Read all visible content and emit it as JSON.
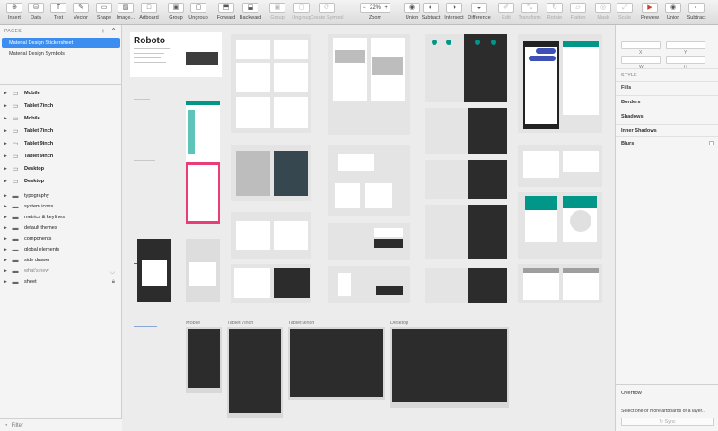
{
  "toolbar": {
    "items": [
      {
        "label": "Insert",
        "icon": "insert-icon",
        "glyph": "⊕",
        "dim": false
      },
      {
        "label": "Data",
        "icon": "data-icon",
        "glyph": "⛁",
        "dim": false
      },
      {
        "label": "Text",
        "icon": "text-icon",
        "glyph": "T",
        "dim": false
      },
      {
        "label": "Vector",
        "icon": "vector-icon",
        "glyph": "✎",
        "dim": false
      },
      {
        "label": "Shape",
        "icon": "shape-icon",
        "glyph": "▭",
        "dim": false
      },
      {
        "label": "Image...",
        "icon": "image-icon",
        "glyph": "▨",
        "dim": false
      },
      {
        "label": "Artboard",
        "icon": "artboard-icon",
        "glyph": "□",
        "dim": false
      },
      {
        "label": "Group",
        "icon": "group-icon",
        "glyph": "▣",
        "dim": false
      },
      {
        "label": "Ungroup",
        "icon": "ungroup-icon",
        "glyph": "▢",
        "dim": false
      },
      {
        "label": "Forward",
        "icon": "forward-icon",
        "glyph": "⬒",
        "dim": false
      },
      {
        "label": "Backward",
        "icon": "backward-icon",
        "glyph": "⬓",
        "dim": false
      },
      {
        "label": "Group",
        "icon": "group-selection-icon",
        "glyph": "▣",
        "dim": true
      },
      {
        "label": "Ungroup",
        "icon": "ungroup-selection-icon",
        "glyph": "▢",
        "dim": true
      },
      {
        "label": "Create Symbol",
        "icon": "create-symbol-icon",
        "glyph": "⟳",
        "dim": true
      },
      {
        "label": "Zoom",
        "icon": "zoom-icon",
        "glyph": "",
        "dim": false
      },
      {
        "label": "Union",
        "icon": "union-icon",
        "glyph": "◉",
        "dim": false
      },
      {
        "label": "Subtract",
        "icon": "subtract-icon",
        "glyph": "◐",
        "dim": false
      },
      {
        "label": "Intersect",
        "icon": "intersect-icon",
        "glyph": "◑",
        "dim": false
      },
      {
        "label": "Difference",
        "icon": "difference-icon",
        "glyph": "◒",
        "dim": false
      },
      {
        "label": "Edit",
        "icon": "edit-icon",
        "glyph": "✐",
        "dim": true
      },
      {
        "label": "Transform",
        "icon": "transform-icon",
        "glyph": "⤡",
        "dim": true
      },
      {
        "label": "Rotate",
        "icon": "rotate-icon",
        "glyph": "↻",
        "dim": true
      },
      {
        "label": "Flatten",
        "icon": "flatten-icon",
        "glyph": "▱",
        "dim": true
      },
      {
        "label": "Mask",
        "icon": "mask-icon",
        "glyph": "◎",
        "dim": true
      },
      {
        "label": "Scale",
        "icon": "scale-icon",
        "glyph": "⤢",
        "dim": true
      },
      {
        "label": "Preview",
        "icon": "preview-icon",
        "glyph": "▶",
        "dim": false
      },
      {
        "label": "Union",
        "icon": "union-right-icon",
        "glyph": "◉",
        "dim": false
      },
      {
        "label": "Subtract",
        "icon": "subtract-right-icon",
        "glyph": "◐",
        "dim": false
      }
    ],
    "zoom_value": "22%",
    "zoom_minus": "−",
    "zoom_plus": "+"
  },
  "sidebar": {
    "pages_header": "PAGES",
    "add_glyph": "+",
    "collapse_glyph": "⌃",
    "pages": [
      {
        "label": "Material Design Stickersheet",
        "active": true
      },
      {
        "label": "Material Design Symbols",
        "active": false
      }
    ],
    "layers": [
      {
        "label": "Mobile",
        "type": "artboard",
        "bold": true,
        "dim": false
      },
      {
        "label": "Tablet 7inch",
        "type": "artboard",
        "bold": true,
        "dim": false
      },
      {
        "label": "Mobile",
        "type": "artboard",
        "bold": true,
        "dim": false
      },
      {
        "label": "Tablet 7inch",
        "type": "artboard",
        "bold": true,
        "dim": false
      },
      {
        "label": "Tablet 9inch",
        "type": "artboard",
        "bold": true,
        "dim": false
      },
      {
        "label": "Tablet 9inch",
        "type": "artboard",
        "bold": true,
        "dim": false
      },
      {
        "label": "Desktop",
        "type": "artboard",
        "bold": true,
        "dim": false
      },
      {
        "label": "Desktop",
        "type": "artboard",
        "bold": true,
        "dim": false
      },
      {
        "label": "typography",
        "type": "folder",
        "bold": false,
        "dim": false
      },
      {
        "label": "system icons",
        "type": "folder",
        "bold": false,
        "dim": false
      },
      {
        "label": "metrics & keylines",
        "type": "folder",
        "bold": false,
        "dim": false
      },
      {
        "label": "default themes",
        "type": "folder",
        "bold": false,
        "dim": false
      },
      {
        "label": "components",
        "type": "folder",
        "bold": false,
        "dim": false
      },
      {
        "label": "global elements",
        "type": "folder",
        "bold": false,
        "dim": false
      },
      {
        "label": "side drawer",
        "type": "folder",
        "bold": false,
        "dim": false
      },
      {
        "label": "what's new",
        "type": "folder",
        "bold": false,
        "dim": true,
        "right_icon": "eye-hidden-icon"
      },
      {
        "label": "sheet",
        "type": "folder",
        "bold": false,
        "dim": false,
        "right_icon": "lock-icon"
      }
    ],
    "filter_label": "Filter",
    "filter_icon": "filter-icon"
  },
  "canvas": {
    "roboto_text": "Roboto",
    "bottom_titles": [
      "Mobile",
      "Tablet 7inch",
      "Tablet 9inch",
      "Desktop"
    ]
  },
  "inspector": {
    "fields": [
      {
        "key": "x",
        "label": "X"
      },
      {
        "key": "y",
        "label": "Y"
      },
      {
        "key": "w",
        "label": "W"
      },
      {
        "key": "h",
        "label": "H"
      }
    ],
    "style_header": "STYLE",
    "sections": [
      "Fills",
      "Borders",
      "Shadows",
      "Inner Shadows",
      "Blurs"
    ],
    "overflow_title": "Overflow",
    "overflow_message": "Select one or more artboards or a layer...",
    "sync_label": "Sync",
    "sync_glyph": "↻"
  },
  "colors": {
    "accent": "#3b8ef0",
    "teal": "#009688",
    "pink": "#e91e63",
    "dark_artboard": "#2c2c2c"
  }
}
